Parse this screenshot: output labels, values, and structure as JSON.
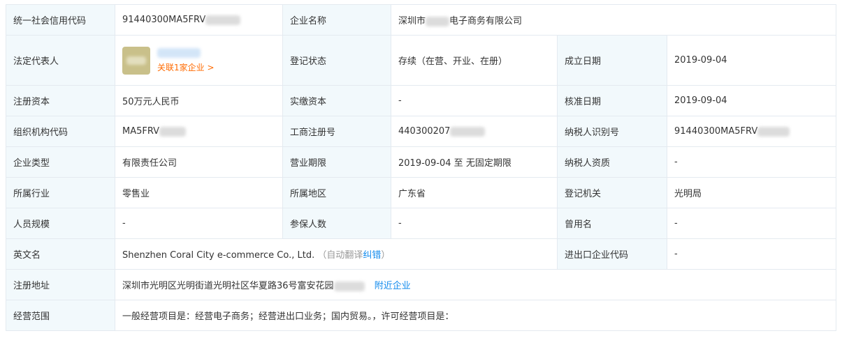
{
  "rows": {
    "r1": {
      "l1": "统一社会信用代码",
      "v1": "91440300MA5FRV",
      "l2": "企业名称",
      "v2a": "深圳市",
      "v2b": "电子商务有限公司"
    },
    "r2": {
      "l1": "法定代表人",
      "legal_rel": "关联1家企业 >",
      "l2": "登记状态",
      "v2": "存续（在营、开业、在册）",
      "l3": "成立日期",
      "v3": "2019-09-04"
    },
    "r3": {
      "l1": "注册资本",
      "v1": "50万元人民币",
      "l2": "实缴资本",
      "v2": "-",
      "l3": "核准日期",
      "v3": "2019-09-04"
    },
    "r4": {
      "l1": "组织机构代码",
      "v1": "MA5FRV",
      "l2": "工商注册号",
      "v2": "440300207",
      "l3": "纳税人识别号",
      "v3": "91440300MA5FRV"
    },
    "r5": {
      "l1": "企业类型",
      "v1": "有限责任公司",
      "l2": "营业期限",
      "v2": "2019-09-04 至 无固定期限",
      "l3": "纳税人资质",
      "v3": "-"
    },
    "r6": {
      "l1": "所属行业",
      "v1": "零售业",
      "l2": "所属地区",
      "v2": "广东省",
      "l3": "登记机关",
      "v3": "光明局"
    },
    "r7": {
      "l1": "人员规模",
      "v1": "-",
      "l2": "参保人数",
      "v2": "-",
      "l3": "曾用名",
      "v3": "-"
    },
    "r8": {
      "l1": "英文名",
      "v1": "Shenzhen Coral City e-commerce Co., Ltd.",
      "auto_open": "（自动翻译",
      "fix": "纠错",
      "auto_close": "）",
      "l3": "进出口企业代码",
      "v3": "-"
    },
    "r9": {
      "l1": "注册地址",
      "v1": "深圳市光明区光明街道光明社区华夏路36号富安花园",
      "nearby": "附近企业"
    },
    "r10": {
      "l1": "经营范围",
      "v1": "一般经营项目是：经营电子商务；经营进出口业务；国内贸易。，许可经营项目是："
    }
  }
}
